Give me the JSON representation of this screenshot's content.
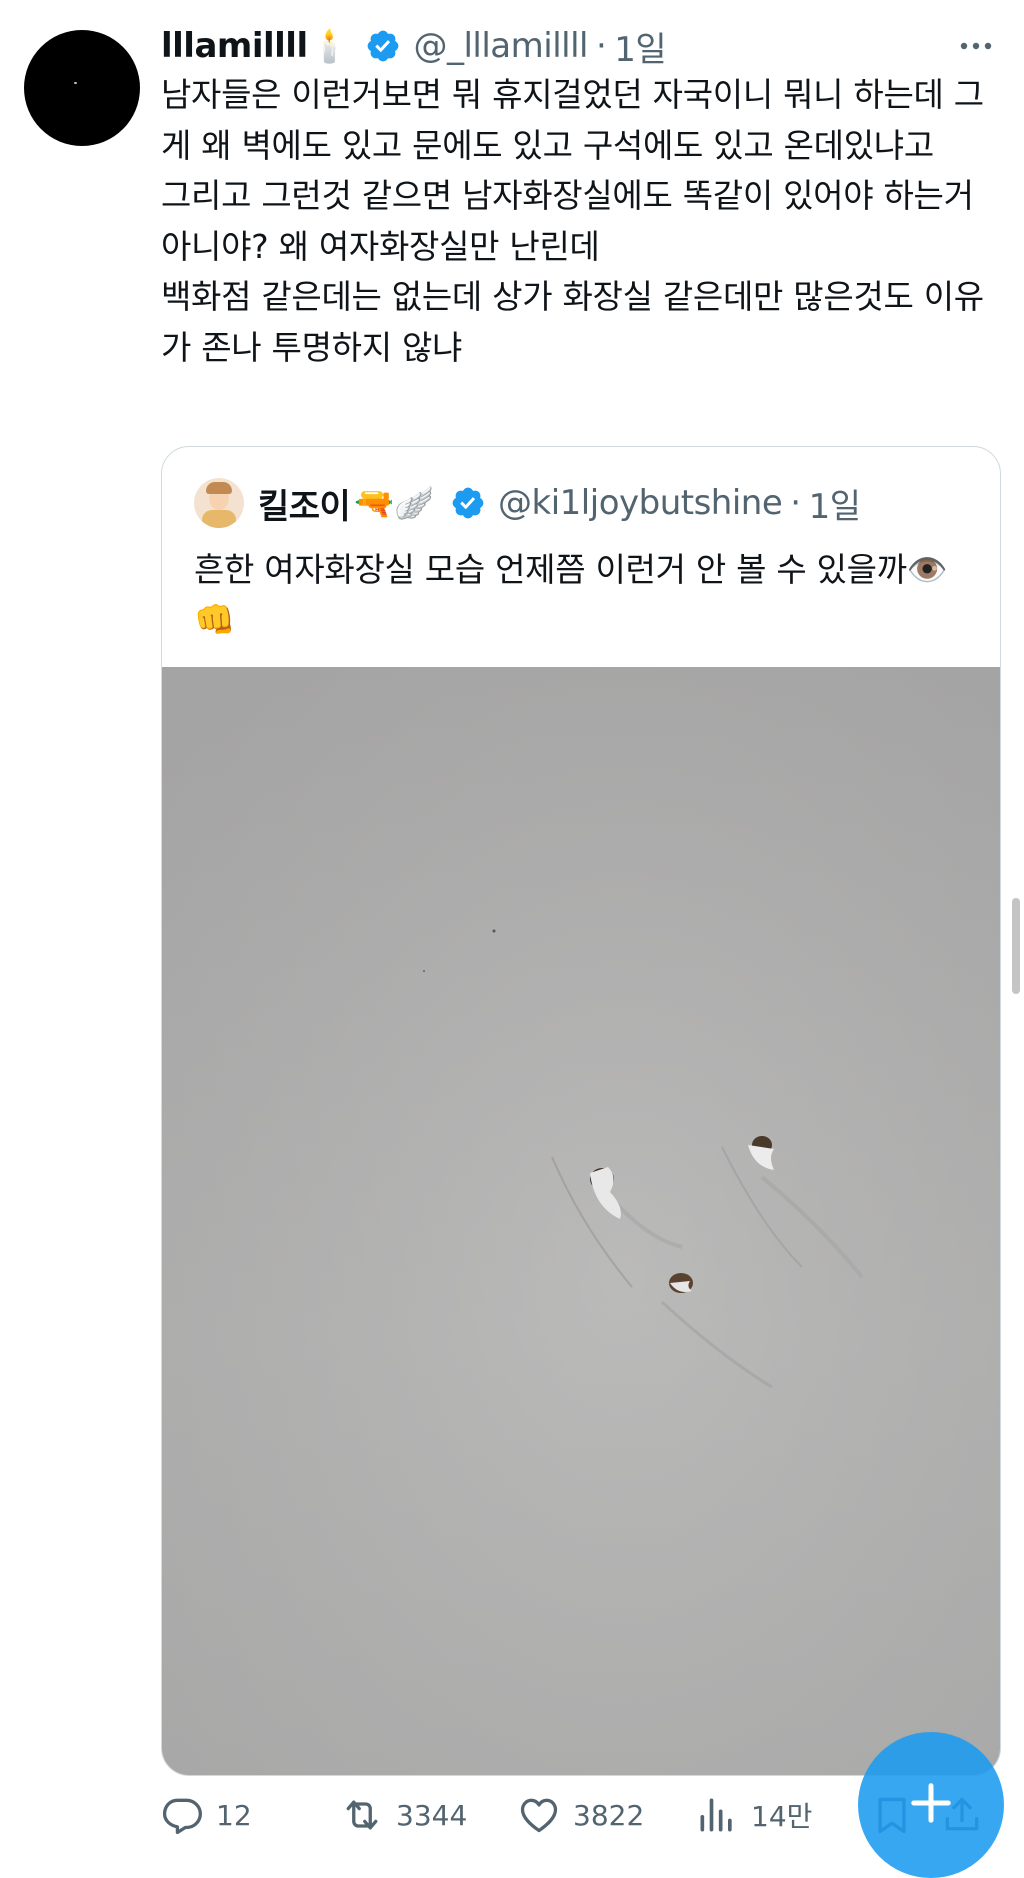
{
  "tweet": {
    "display_name": "lllamillll",
    "name_emoji": "🕯️",
    "handle": "@_lllamillll",
    "separator": "·",
    "time": "1일",
    "text_lines": [
      "남자들은 이런거보면 뭐 휴지걸었던 자국이니 뭐니 하는데 그게 왜 벽에도 있고 문에도 있고 구석에도 있고 온데있냐고",
      "그리고 그런것 같으면 남자화장실에도 똑같이 있어야 하는거 아니야? 왜 여자화장실만 난린데",
      "백화점 같은데는 없는데 상가 화장실 같은데만 많은것도 이유가 존나 투명하지 않냐"
    ]
  },
  "quoted": {
    "display_name": "킬조이",
    "name_emoji": "🔫🪽",
    "handle": "@ki1ljoybutshine",
    "separator": "·",
    "time": "1일",
    "text": "흔한 여자화장실 모습 언제쯤 이런거 안 볼 수 있을까👁️👊"
  },
  "actions": {
    "reply_count": "12",
    "retweet_count": "3344",
    "like_count": "3822",
    "views_count": "14만"
  },
  "icons": {
    "verified": "verified-badge-icon",
    "more": "more-horizontal-icon",
    "reply": "reply-icon",
    "retweet": "retweet-icon",
    "like": "heart-icon",
    "views": "views-chart-icon",
    "bookmark": "bookmark-icon",
    "share": "share-icon",
    "compose": "plus-icon"
  },
  "colors": {
    "verified": "#1d9bf0",
    "secondary_text": "#536471",
    "fab": "#1d9bf0"
  }
}
